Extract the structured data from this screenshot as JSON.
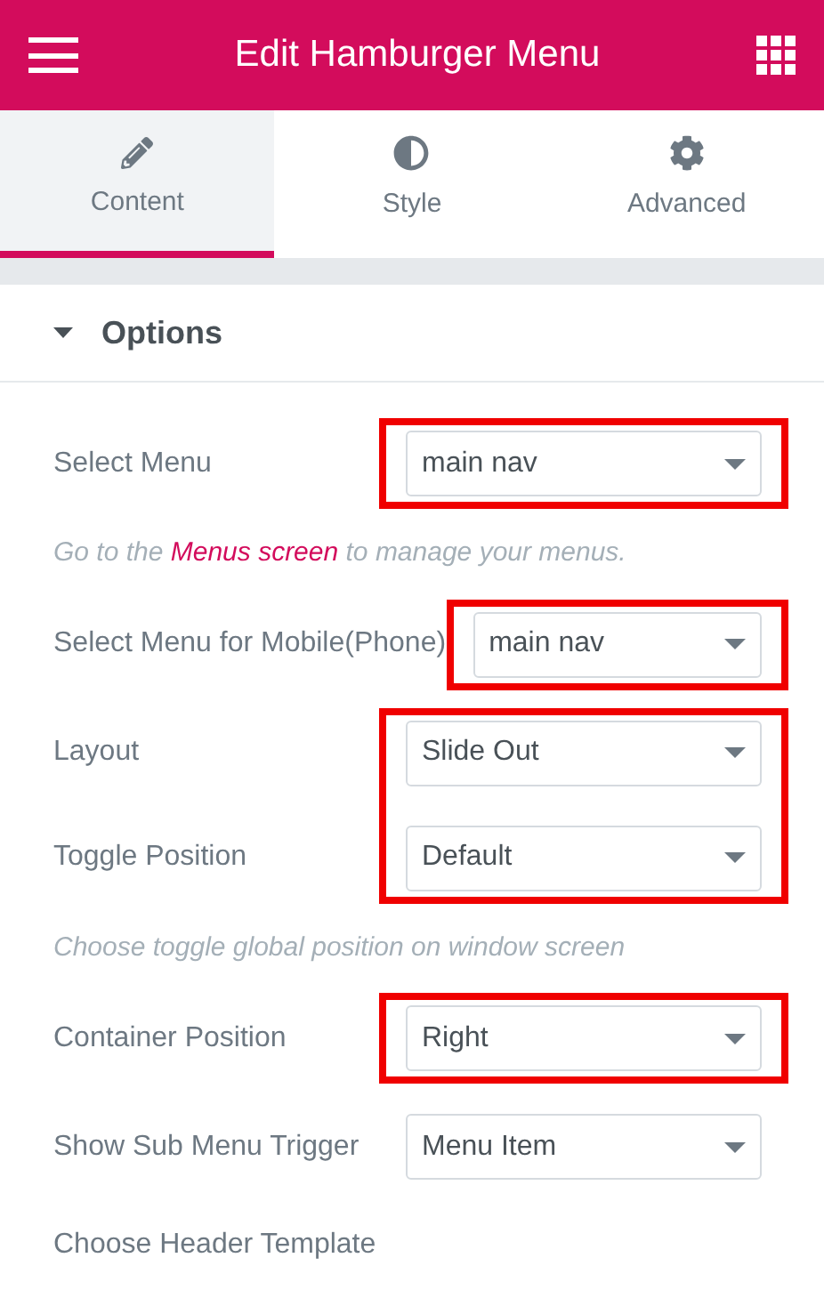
{
  "header": {
    "title": "Edit Hamburger Menu"
  },
  "tabs": [
    {
      "label": "Content",
      "selected": true
    },
    {
      "label": "Style",
      "selected": false
    },
    {
      "label": "Advanced",
      "selected": false
    }
  ],
  "section": {
    "title": "Options",
    "expanded": true
  },
  "controls": [
    {
      "kind": "group",
      "highlighted": true,
      "rows": [
        {
          "label": "Select Menu",
          "value": "main nav"
        }
      ]
    },
    {
      "kind": "note",
      "parts": [
        {
          "text": "Go to the ",
          "link": false
        },
        {
          "text": "Menus screen",
          "link": true
        },
        {
          "text": " to manage your menus.",
          "link": false
        }
      ]
    },
    {
      "kind": "group",
      "highlighted": true,
      "rows": [
        {
          "label": "Select Menu for Mobile(Phone)",
          "value": "main nav"
        }
      ]
    },
    {
      "kind": "group",
      "highlighted": true,
      "rows": [
        {
          "label": "Layout",
          "value": "Slide Out"
        },
        {
          "label": "Toggle Position",
          "value": "Default"
        }
      ]
    },
    {
      "kind": "note",
      "parts": [
        {
          "text": "Choose toggle global position on window screen",
          "link": false
        }
      ]
    },
    {
      "kind": "group",
      "highlighted": true,
      "rows": [
        {
          "label": "Container Position",
          "value": "Right"
        }
      ]
    },
    {
      "kind": "group",
      "highlighted": false,
      "rows": [
        {
          "label": "Show Sub Menu Trigger",
          "value": "Menu Item"
        }
      ]
    },
    {
      "kind": "label",
      "text": "Choose Header Template"
    }
  ]
}
